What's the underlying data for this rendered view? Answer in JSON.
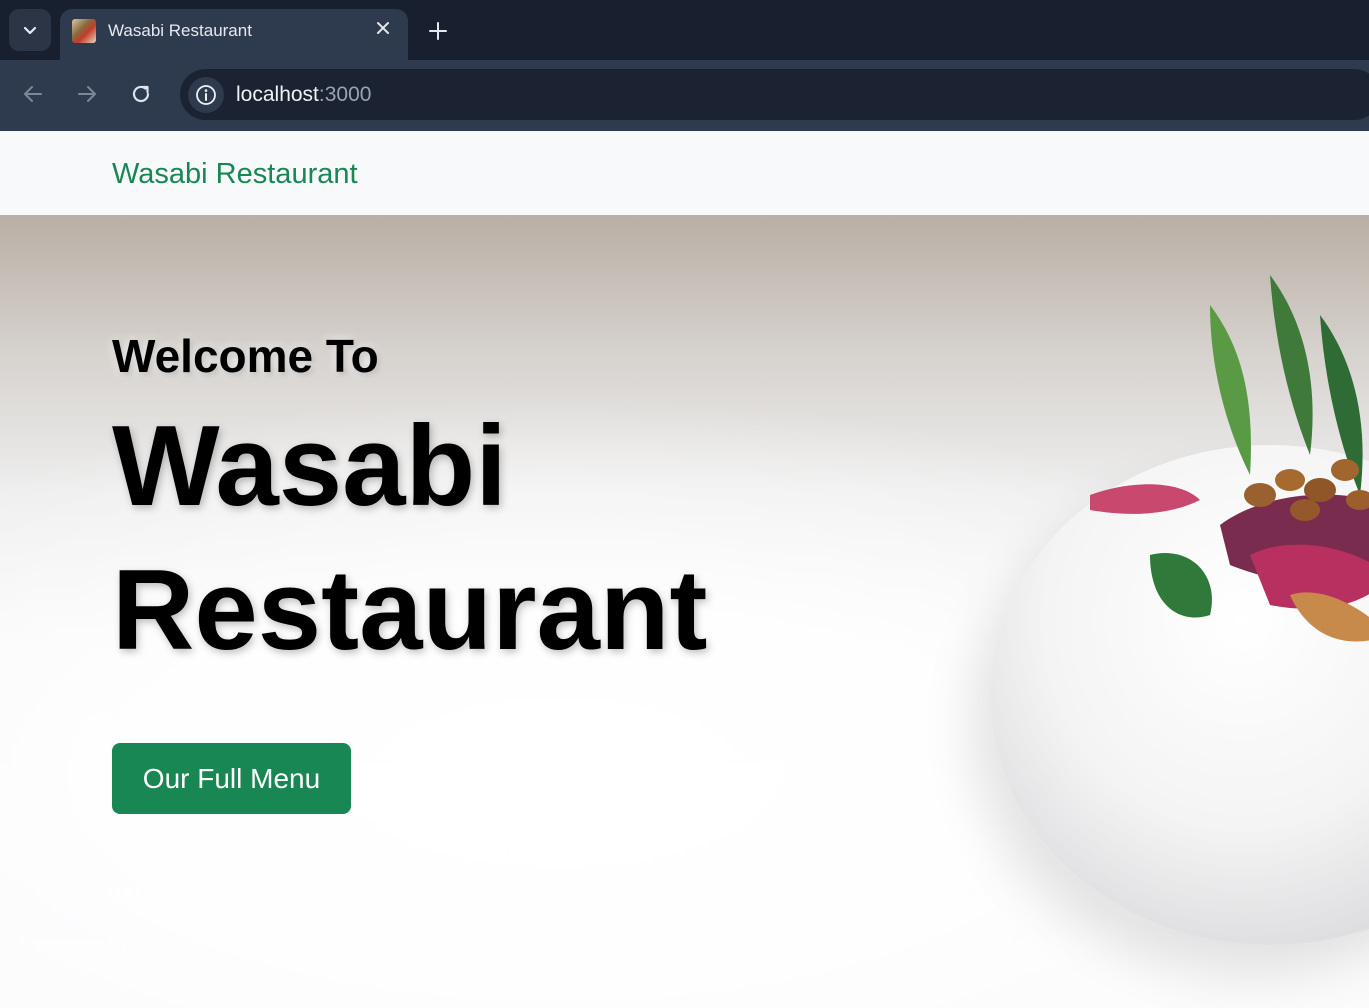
{
  "browser": {
    "tab": {
      "title": "Wasabi Restaurant"
    },
    "address": {
      "host": "localhost",
      "port": ":3000"
    }
  },
  "site": {
    "brand": "Wasabi Restaurant"
  },
  "hero": {
    "welcome": "Welcome To",
    "title_line1": "Wasabi",
    "title_line2": "Restaurant",
    "cta_label": "Our Full Menu"
  },
  "colors": {
    "brand_green": "#198754",
    "chrome_dark": "#182030",
    "chrome_toolbar": "#2e3a4d"
  },
  "icons": [
    "chevron-down-icon",
    "favicon",
    "close-icon",
    "plus-icon",
    "back-arrow-icon",
    "forward-arrow-icon",
    "reload-icon",
    "info-icon"
  ]
}
